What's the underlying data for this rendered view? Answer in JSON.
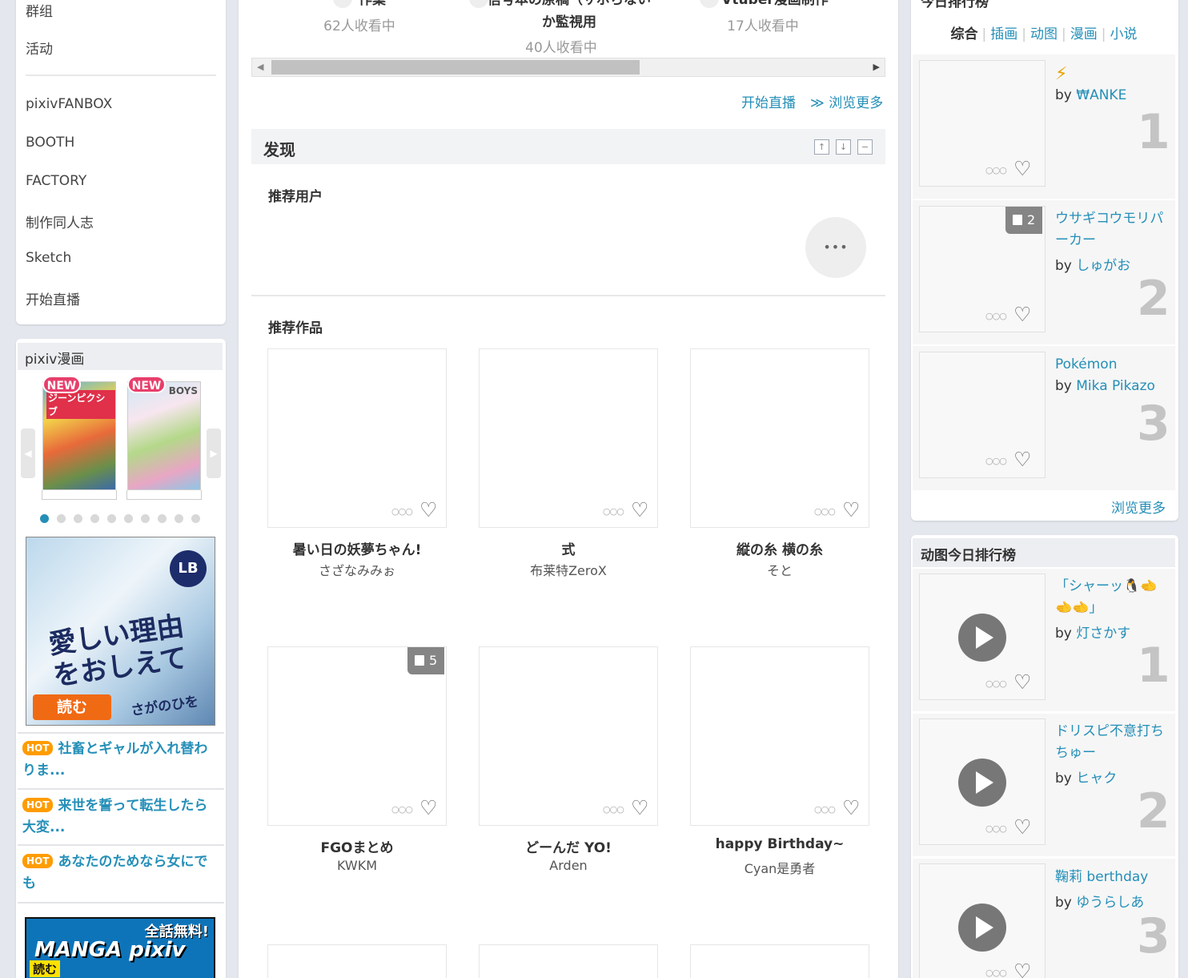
{
  "left_nav": {
    "items": [
      "群组",
      "活动",
      "pixivFANBOX",
      "BOOTH",
      "FACTORY",
      "制作同人志",
      "Sketch",
      "开始直播"
    ]
  },
  "manga": {
    "title": "pixiv漫画",
    "new_badge": "NEW",
    "cover1_text": "ジーンピクシブ",
    "cover2_text": "BOYS",
    "banner_text": "愛しい理由をおしえて",
    "banner_author": "さがのひを",
    "banner_read": "読む",
    "banner_logo": "LB",
    "hot_badge": "HOT",
    "hot_items": [
      "社畜とギャルが入れ替わりま...",
      "来世を誓って転生したら大変...",
      "あなたのためなら女にでも"
    ],
    "bottom_banner_free": "全話無料!",
    "bottom_banner_logo": "MANGA pixiv",
    "bottom_banner_read": "読む"
  },
  "live": {
    "items": [
      {
        "title": "作業",
        "viewers": "62人收看中"
      },
      {
        "title": "信号本の原稿（サボらないか監視用",
        "viewers": "40人收看中"
      },
      {
        "title": "Vtuber漫画制作",
        "viewers": "17人收看中"
      }
    ],
    "start_live": "开始直播",
    "view_more": "≫ 浏览更多"
  },
  "discover": {
    "title": "发现",
    "recommended_users": "推荐用户",
    "more_dots": "•••",
    "recommended_works": "推荐作品",
    "works": [
      {
        "title": "暑い日の妖夢ちゃん!",
        "author": "さざなみみぉ",
        "pages": ""
      },
      {
        "title": "式",
        "author": "布莱特ZeroX",
        "pages": ""
      },
      {
        "title": "縦の糸 横の糸",
        "author": "そと",
        "pages": ""
      },
      {
        "title": "FGOまとめ",
        "author": "KWKM",
        "pages": "5"
      },
      {
        "title": "どーんだ YO!",
        "author": "Arden",
        "pages": ""
      },
      {
        "title": "happy Birthday~",
        "author": "Cyan是勇者",
        "pages": ""
      }
    ]
  },
  "ranking": {
    "title": "今日排行榜",
    "tabs": [
      "综合",
      "插画",
      "动图",
      "漫画",
      "小说"
    ],
    "by": "by",
    "items": [
      {
        "rank": "1",
        "title": "⚡",
        "author": "₩ANKE",
        "pages": ""
      },
      {
        "rank": "2",
        "title": "ウサギコウモリパーカー",
        "author": "しゅがお",
        "pages": "2"
      },
      {
        "rank": "3",
        "title": "Pokémon",
        "author": "Mika Pikazo",
        "pages": ""
      }
    ],
    "view_more": "浏览更多"
  },
  "ugoira": {
    "title": "动图今日排行榜",
    "items": [
      {
        "rank": "1",
        "title": "「シャーッ🐧🫲🫲🫲」",
        "author": "灯さかす"
      },
      {
        "rank": "2",
        "title": "ドリスピ不意打ちちゅー",
        "author": "ヒャク"
      },
      {
        "rank": "3",
        "title": "鞠莉 berthday",
        "author": "ゆうらしあ"
      }
    ]
  }
}
